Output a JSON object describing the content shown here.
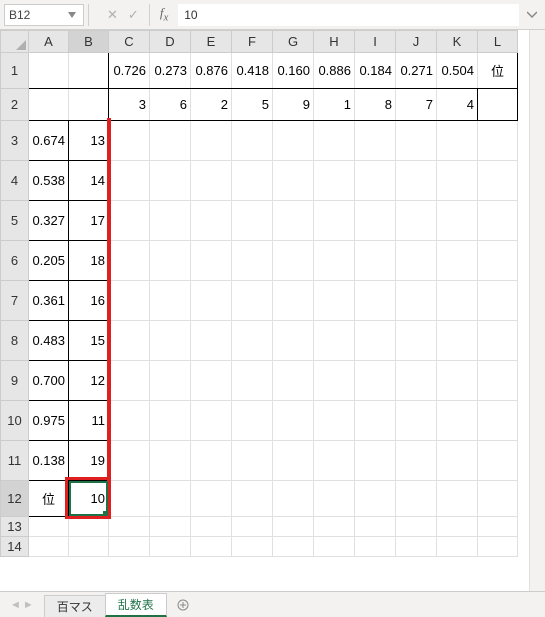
{
  "namebox": {
    "value": "B12"
  },
  "formula": {
    "value": "10"
  },
  "columns": [
    "A",
    "B",
    "C",
    "D",
    "E",
    "F",
    "G",
    "H",
    "I",
    "J",
    "K",
    "L"
  ],
  "rows": [
    "1",
    "2",
    "3",
    "4",
    "5",
    "6",
    "7",
    "8",
    "9",
    "10",
    "11",
    "12",
    "13",
    "14"
  ],
  "chart_data": {
    "type": "table",
    "title": "",
    "row1": {
      "C": "0.726",
      "D": "0.273",
      "E": "0.876",
      "F": "0.418",
      "G": "0.160",
      "H": "0.886",
      "I": "0.184",
      "J": "0.271",
      "K": "0.504",
      "L": "位"
    },
    "row2": {
      "C": "3",
      "D": "6",
      "E": "2",
      "F": "5",
      "G": "9",
      "H": "1",
      "I": "8",
      "J": "7",
      "K": "4"
    },
    "colA_3_11": [
      "0.674",
      "0.538",
      "0.327",
      "0.205",
      "0.361",
      "0.483",
      "0.700",
      "0.975",
      "0.138"
    ],
    "colB_3_11": [
      "13",
      "14",
      "17",
      "18",
      "16",
      "15",
      "12",
      "11",
      "19"
    ],
    "row12": {
      "A": "位",
      "B": "10"
    }
  },
  "sheets": {
    "tab1": "百マス",
    "tab2": "乱数表"
  },
  "selected_col": "B",
  "selected_row": "12"
}
